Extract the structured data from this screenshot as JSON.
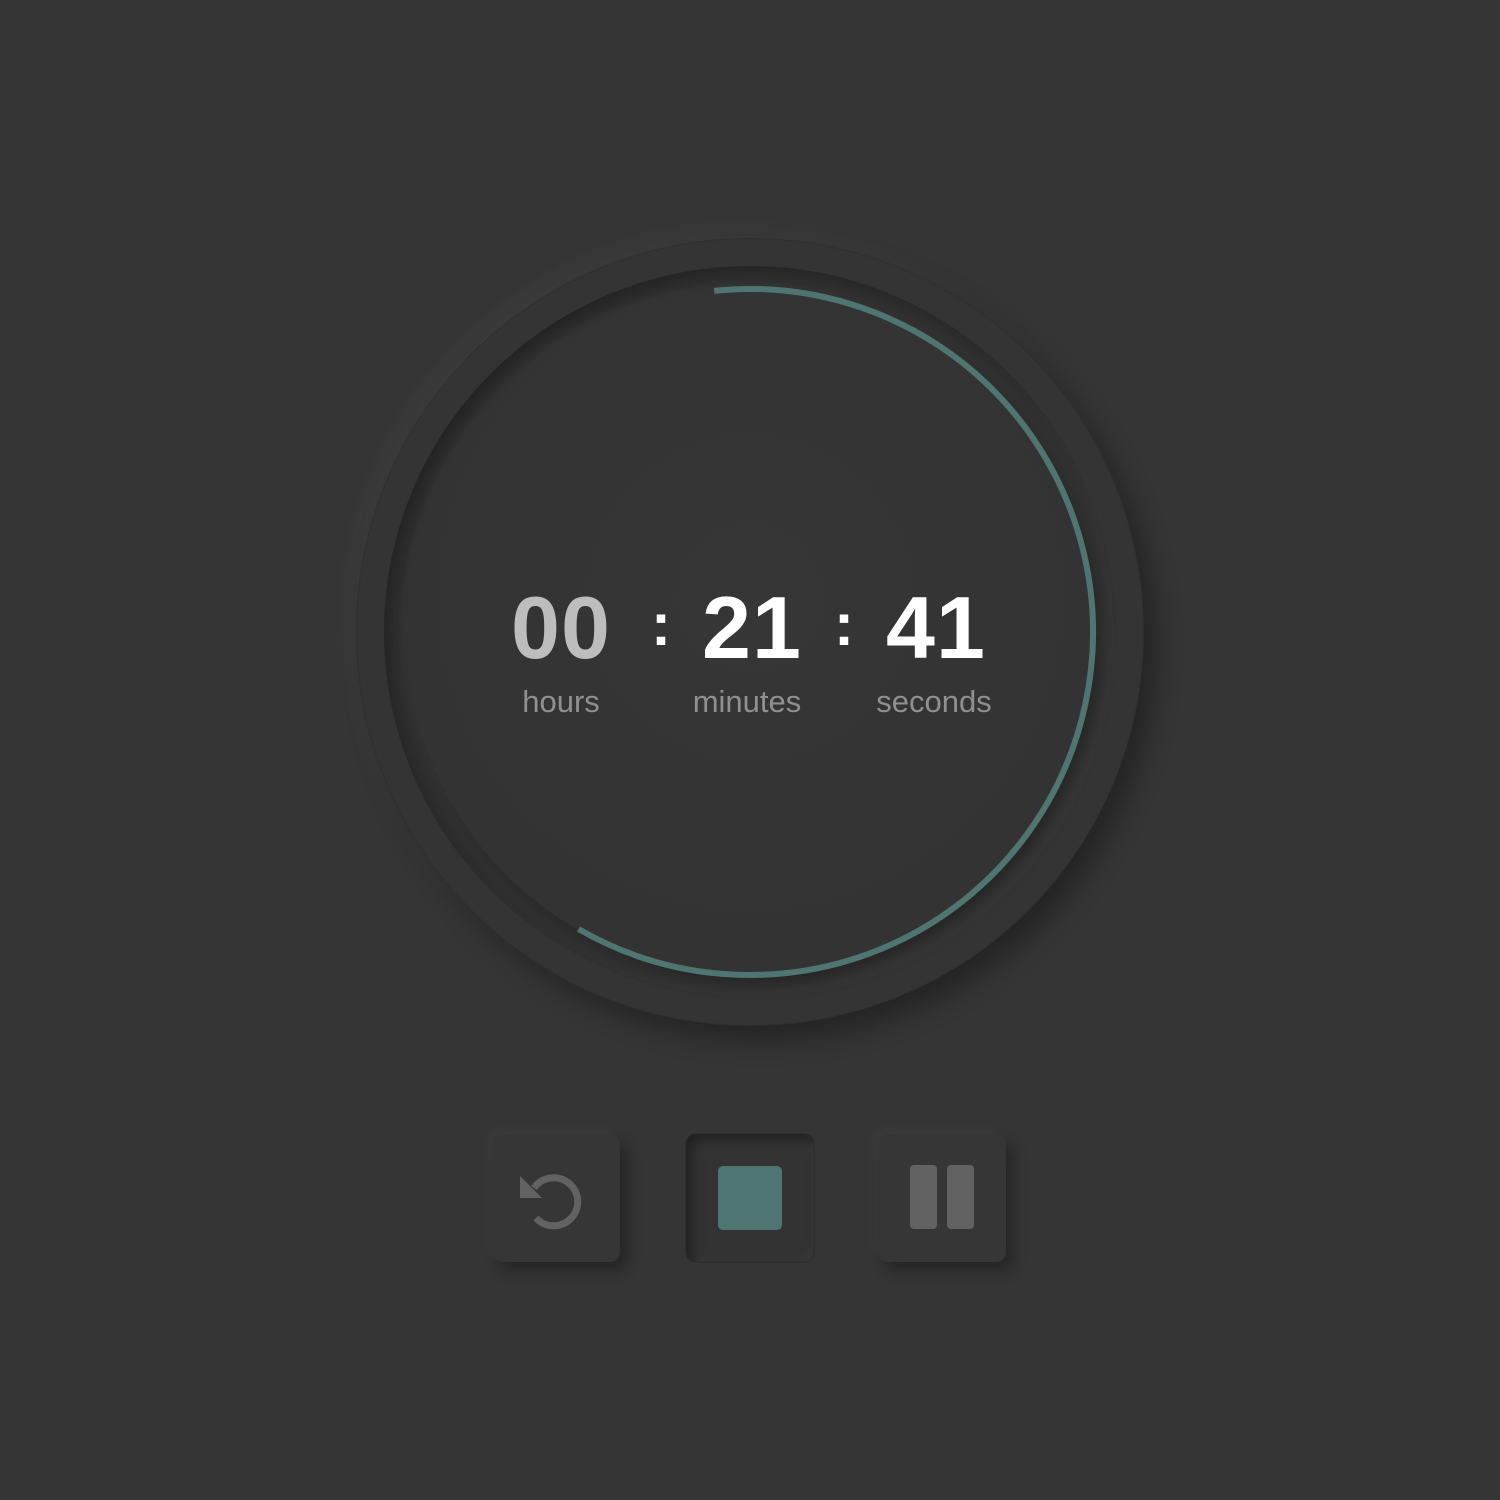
{
  "timer": {
    "hours": "00",
    "minutes": "21",
    "seconds": "41",
    "separator": ":",
    "labels": {
      "hours": "hours",
      "minutes": "minutes",
      "seconds": "seconds"
    },
    "progress_fraction": 0.6,
    "progress_start_angle_deg": -6
  },
  "controls": {
    "reset_icon": "reset-icon",
    "stop_icon": "stop-icon",
    "pause_icon": "pause-icon"
  },
  "colors": {
    "background": "#353535",
    "accent": "#4f7572",
    "icon_muted": "#626262",
    "digits_active": "#ffffff",
    "digits_inactive": "#bdbdbd",
    "label": "#909090"
  }
}
